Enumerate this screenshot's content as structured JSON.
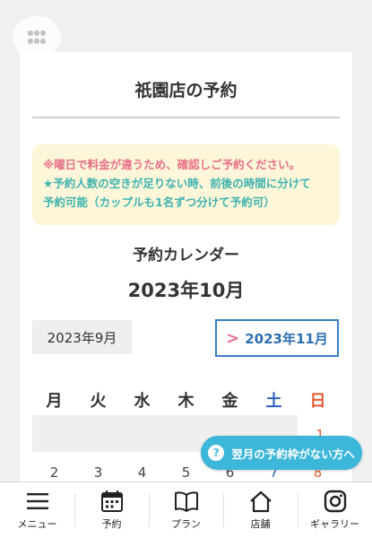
{
  "title": "祇園店の予約",
  "notice": {
    "line1": "※曜日で料金が違うため、確認しご予約ください。",
    "line2": "★予約人数の空きが足りない時、前後の時間に分けて",
    "line3": "予約可能（カップルも1名ずつ分けて予約可）"
  },
  "calendar": {
    "heading": "予約カレンダー",
    "current_month": "2023年10月",
    "prev_month": "2023年9月",
    "next_chevron": ">",
    "next_month": "2023年11月",
    "weekdays": [
      "月",
      "火",
      "水",
      "木",
      "金",
      "土",
      "日"
    ],
    "first_day": "1",
    "week2": [
      "2",
      "3",
      "4",
      "5",
      "6",
      "7",
      "8"
    ]
  },
  "float_button": {
    "icon": "?",
    "label": "翌月の予約枠がない方へ"
  },
  "tabbar": [
    {
      "label": "メニュー",
      "icon": "hamburger-menu-icon"
    },
    {
      "label": "予約",
      "icon": "calendar-icon"
    },
    {
      "label": "プラン",
      "icon": "book-icon"
    },
    {
      "label": "店舗",
      "icon": "home-icon"
    },
    {
      "label": "ギャラリー",
      "icon": "instagram-icon"
    }
  ],
  "colors": {
    "accent_pink": "#e8708a",
    "accent_teal": "#3eb3b0",
    "link_blue": "#2d6fb0",
    "float_button": "#3cb6d9",
    "saturday": "#2d5fc2",
    "sunday": "#e25a2f"
  }
}
